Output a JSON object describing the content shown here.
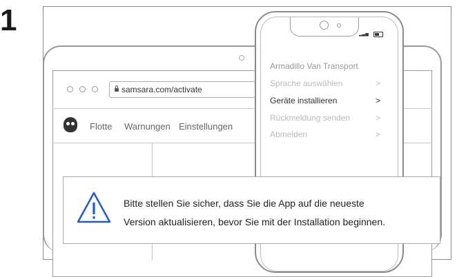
{
  "step_number": "1",
  "browser": {
    "url": "samsara.com/activate"
  },
  "nav": {
    "items": [
      "Flotte",
      "Warnungen",
      "Einstellungen"
    ]
  },
  "phone": {
    "title": "Armadillo Van Transport",
    "menu": [
      {
        "label": "Sprache auswählen",
        "chevron": ">"
      },
      {
        "label": "Geräte installieren",
        "chevron": ">"
      },
      {
        "label": "Rückmeldung senden",
        "chevron": ">"
      },
      {
        "label": "Abmelden",
        "chevron": ">"
      }
    ],
    "active_item": "Geräte installieren"
  },
  "alert": {
    "line1": "Bitte stellen Sie sicher, dass Sie die App auf die neueste",
    "line2": "Version aktualisieren, bevor Sie mit der Installation beginnen.",
    "accent_color": "#1a5ec8"
  }
}
